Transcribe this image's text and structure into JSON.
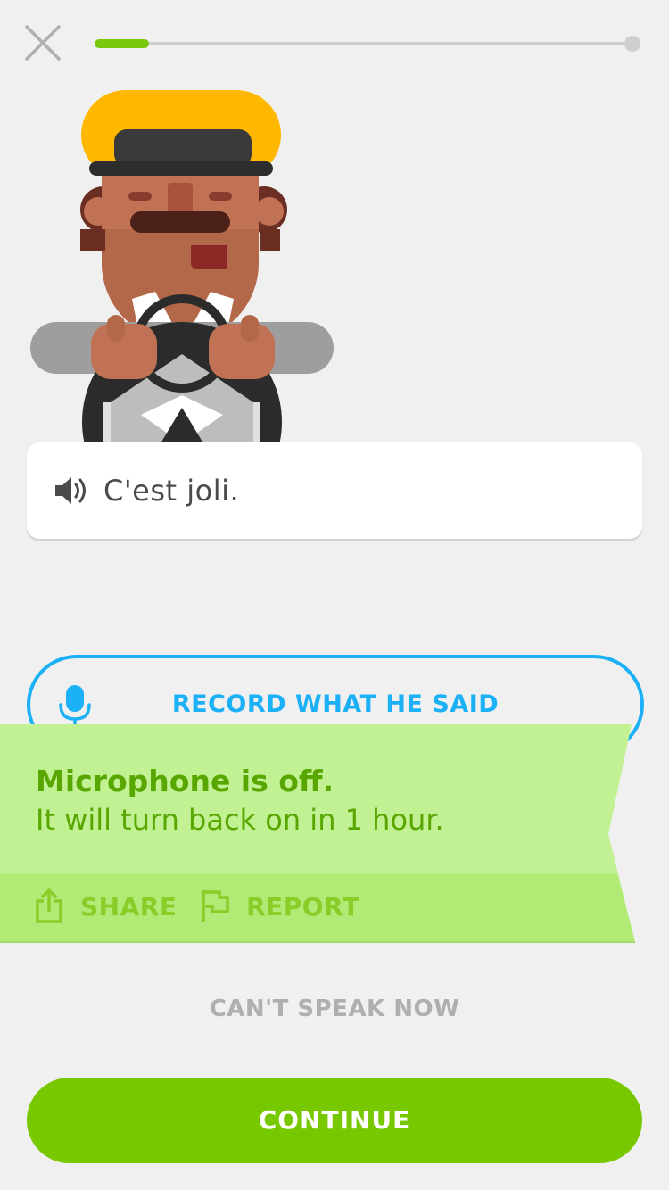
{
  "header": {
    "close_icon": "close-icon",
    "progress": 0.1
  },
  "prompt": {
    "speaker_icon": "speaker-icon",
    "text": "C'est joli."
  },
  "record": {
    "icon": "microphone-icon",
    "label": "RECORD WHAT HE SAID"
  },
  "banner": {
    "title": "Microphone is off.",
    "subtitle": "It will turn back on in 1 hour.",
    "share_icon": "share-icon",
    "share_label": "SHARE",
    "report_icon": "flag-icon",
    "report_label": "REPORT"
  },
  "footer": {
    "cant_speak_label": "CAN'T SPEAK NOW",
    "continue_label": "CONTINUE"
  },
  "colors": {
    "accent_blue": "#1cb0f6",
    "progress_green": "#7ac70c",
    "banner_bg": "#c2f193",
    "banner_text": "#58a700",
    "continue_bg": "#78c800"
  }
}
